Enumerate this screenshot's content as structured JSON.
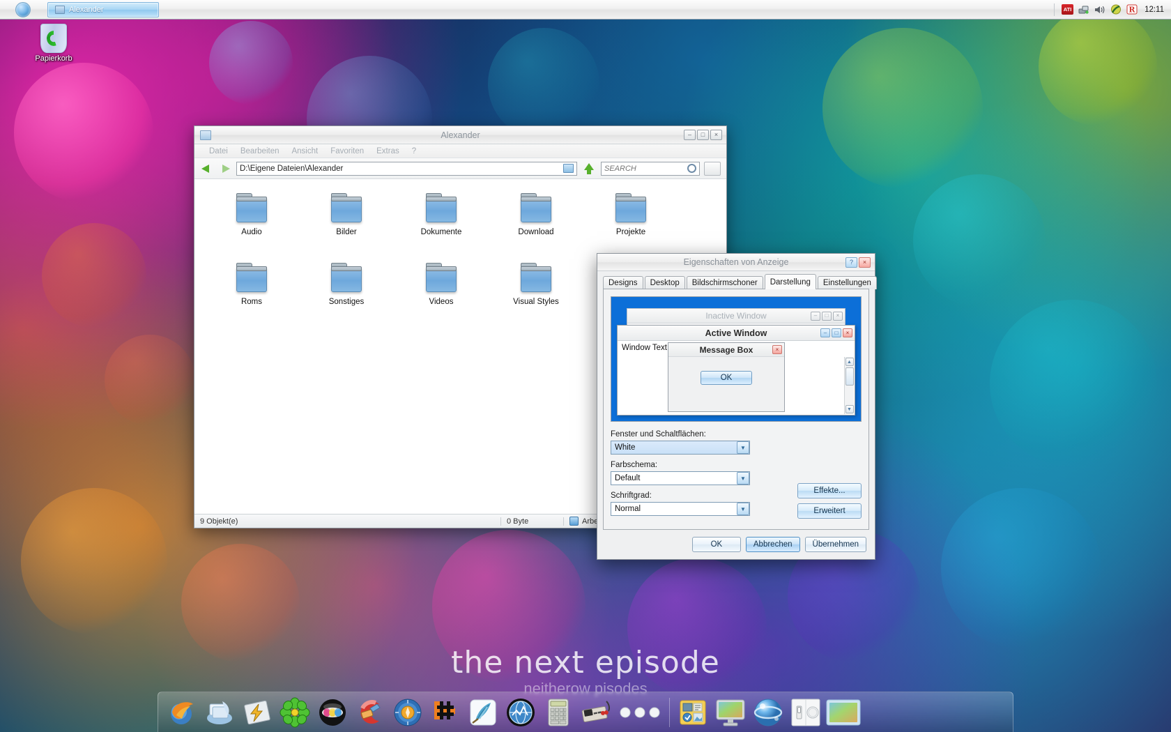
{
  "taskbar": {
    "start_icon": "start-orb-icon",
    "tasks": [
      {
        "label": "Alexander",
        "icon": "folder-icon",
        "active": true
      }
    ],
    "tray": {
      "icons": [
        "ati-icon",
        "network-icon",
        "volume-icon",
        "nero-icon",
        "avira-icon"
      ],
      "ati_label": "ATI",
      "clock": "12:11"
    }
  },
  "desktop": {
    "icons": [
      {
        "label": "Papierkorb",
        "icon": "recycle-bin-icon"
      }
    ],
    "wallpaper_text": "the next episode",
    "wallpaper_subtext": "neitherow    pisodes"
  },
  "explorer": {
    "title": "Alexander",
    "window_buttons": {
      "minimize": "–",
      "maximize": "□",
      "close": "×"
    },
    "menu": [
      "Datei",
      "Bearbeiten",
      "Ansicht",
      "Favoriten",
      "Extras",
      "?"
    ],
    "toolbar": {
      "back": "back-arrow-icon",
      "forward": "forward-arrow-icon",
      "path_value": "D:\\Eigene Dateien\\Alexander",
      "up": "up-arrow-icon",
      "search_placeholder": "SEARCH",
      "search_value": "",
      "view_button": "view-mode-icon"
    },
    "items": [
      {
        "name": "Audio",
        "icon": "folder-icon"
      },
      {
        "name": "Bilder",
        "icon": "folder-icon"
      },
      {
        "name": "Dokumente",
        "icon": "folder-icon"
      },
      {
        "name": "Download",
        "icon": "folder-icon"
      },
      {
        "name": "Projekte",
        "icon": "folder-icon"
      },
      {
        "name": "Roms",
        "icon": "folder-icon"
      },
      {
        "name": "Sonstiges",
        "icon": "folder-icon"
      },
      {
        "name": "Videos",
        "icon": "folder-icon"
      },
      {
        "name": "Visual Styles",
        "icon": "folder-icon"
      }
    ],
    "status": {
      "count": "9 Objekt(e)",
      "size": "0 Byte",
      "location": "Arbeitsplatz"
    }
  },
  "dialog": {
    "title": "Eigenschaften von Anzeige",
    "window_buttons": {
      "help": "?",
      "close": "×"
    },
    "tabs": [
      {
        "label": "Designs",
        "active": false
      },
      {
        "label": "Desktop",
        "active": false
      },
      {
        "label": "Bildschirmschoner",
        "active": false
      },
      {
        "label": "Darstellung",
        "active": true
      },
      {
        "label": "Einstellungen",
        "active": false
      }
    ],
    "preview": {
      "inactive_window_title": "Inactive Window",
      "active_window_title": "Active Window",
      "window_text": "Window Text",
      "message_box_title": "Message Box",
      "ok_label": "OK",
      "inactive_buttons": {
        "minimize": "–",
        "maximize": "□",
        "close": "×"
      },
      "active_buttons": {
        "minimize": "–",
        "maximize": "□",
        "close": "×"
      },
      "message_close": "×",
      "scroll_up": "▲",
      "scroll_down": "▼",
      "background_color": "#0c6fd8"
    },
    "fields": [
      {
        "label": "Fenster und Schaltflächen:",
        "value": "White",
        "selected": true
      },
      {
        "label": "Farbschema:",
        "value": "Default",
        "selected": false
      },
      {
        "label": "Schriftgrad:",
        "value": "Normal",
        "selected": false
      }
    ],
    "side_buttons": [
      {
        "label": "Effekte..."
      },
      {
        "label": "Erweitert"
      }
    ],
    "footer_buttons": [
      {
        "label": "OK",
        "focus": false
      },
      {
        "label": "Abbrechen",
        "focus": true
      },
      {
        "label": "Übernehmen",
        "focus": false
      }
    ]
  },
  "dock": {
    "items": [
      {
        "name": "firefox-icon"
      },
      {
        "name": "emule-icon"
      },
      {
        "name": "winamp-icon"
      },
      {
        "name": "icq-icon"
      },
      {
        "name": "dvd-sphere-icon"
      },
      {
        "name": "ccleaner-icon"
      },
      {
        "name": "clock-compass-icon"
      },
      {
        "name": "limewire-icon"
      },
      {
        "name": "feather-editor-icon"
      },
      {
        "name": "network-sphere-icon"
      },
      {
        "name": "calculator-icon"
      },
      {
        "name": "nes-controller-icon"
      },
      {
        "name": "more-dots-icon"
      },
      {
        "name": "yellow-folder-icon"
      },
      {
        "name": "monitor-icon"
      },
      {
        "name": "blue-orb-icon"
      },
      {
        "name": "switch-panel-icon"
      },
      {
        "name": "display-monitor-icon"
      }
    ]
  }
}
